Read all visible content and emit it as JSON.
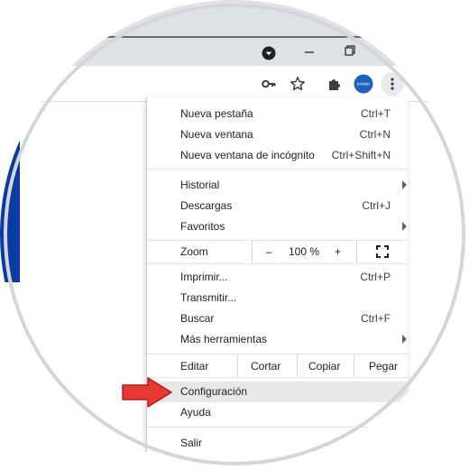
{
  "toolbar": {
    "key_icon": "key-icon",
    "star_icon": "star-icon",
    "extensions_icon": "puzzle-icon",
    "avatar_text": "Solvetic",
    "menu_icon": "three-dots-icon"
  },
  "titlebar": {
    "dropdown_icon": "tab-search-icon",
    "minimize_icon": "minimize-icon",
    "restore_icon": "restore-icon"
  },
  "menu": {
    "new_tab": {
      "label": "Nueva pestaña",
      "shortcut": "Ctrl+T"
    },
    "new_window": {
      "label": "Nueva ventana",
      "shortcut": "Ctrl+N"
    },
    "incognito": {
      "label": "Nueva ventana de incógnito",
      "shortcut": "Ctrl+Shift+N"
    },
    "history": {
      "label": "Historial"
    },
    "downloads": {
      "label": "Descargas",
      "shortcut": "Ctrl+J"
    },
    "bookmarks": {
      "label": "Favoritos"
    },
    "zoom": {
      "label": "Zoom",
      "minus": "–",
      "value": "100 %",
      "plus": "+"
    },
    "print": {
      "label": "Imprimir...",
      "shortcut": "Ctrl+P"
    },
    "cast": {
      "label": "Transmitir..."
    },
    "find": {
      "label": "Buscar",
      "shortcut": "Ctrl+F"
    },
    "more_tools": {
      "label": "Más herramientas"
    },
    "edit": {
      "label": "Editar",
      "cut": "Cortar",
      "copy": "Copiar",
      "paste": "Pegar"
    },
    "settings": {
      "label": "Configuración"
    },
    "help": {
      "label": "Ayuda"
    },
    "exit": {
      "label": "Salir"
    }
  },
  "colors": {
    "arrow": "#e53935",
    "highlight": "#e8e8e8",
    "page_accent": "#0b3aa3"
  }
}
